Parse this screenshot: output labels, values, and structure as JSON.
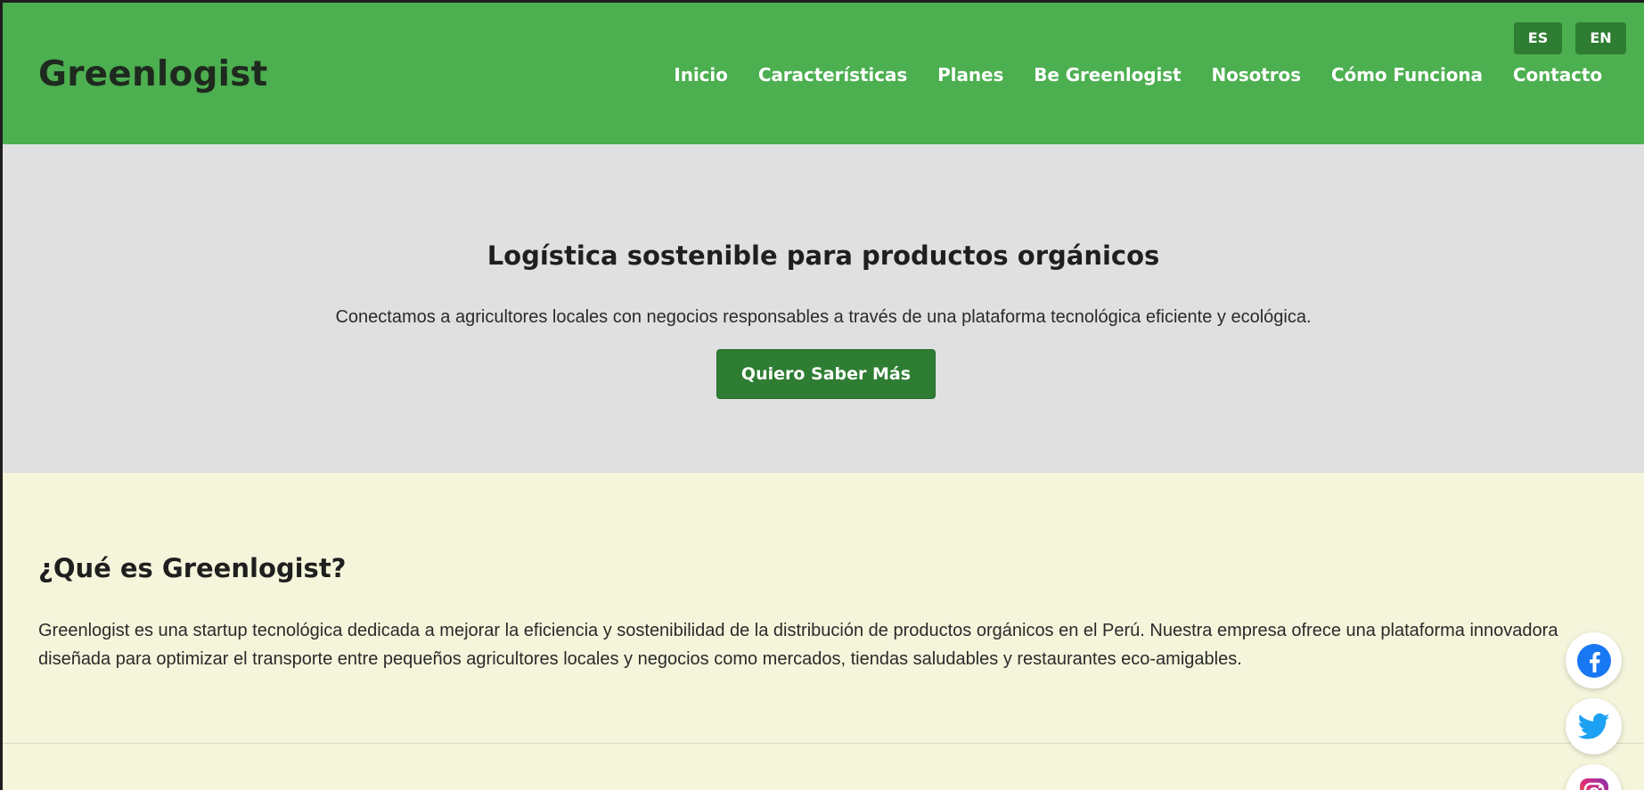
{
  "header": {
    "brand": "Greenlogist",
    "nav": [
      {
        "label": "Inicio"
      },
      {
        "label": "Características"
      },
      {
        "label": "Planes"
      },
      {
        "label": "Be Greenlogist"
      },
      {
        "label": "Nosotros"
      },
      {
        "label": "Cómo Funciona"
      },
      {
        "label": "Contacto"
      }
    ],
    "languages": [
      {
        "label": "ES"
      },
      {
        "label": "EN"
      }
    ]
  },
  "hero": {
    "title": "Logística sostenible para productos orgánicos",
    "subtitle": "Conectamos a agricultores locales con negocios responsables a través de una plataforma tecnológica eficiente y ecológica.",
    "cta_label": "Quiero Saber Más"
  },
  "about": {
    "title": "¿Qué es Greenlogist?",
    "body": "Greenlogist es una startup tecnológica dedicada a mejorar la eficiencia y sostenibilidad de la distribución de productos orgánicos en el Perú. Nuestra empresa ofrece una plataforma innovadora diseñada para optimizar el transporte entre pequeños agricultores locales y negocios como mercados, tiendas saludables y restaurantes eco-amigables."
  },
  "social": [
    {
      "icon": "facebook-icon",
      "color": "#1877f2"
    },
    {
      "icon": "twitter-icon",
      "color": "#1da1f2"
    },
    {
      "icon": "instagram-icon",
      "color": "#c13584"
    }
  ],
  "colors": {
    "header_bg": "#4caf50",
    "button_bg": "#2e7d32",
    "hero_bg": "#e0e0e0",
    "about_bg": "#f5f5dc"
  }
}
